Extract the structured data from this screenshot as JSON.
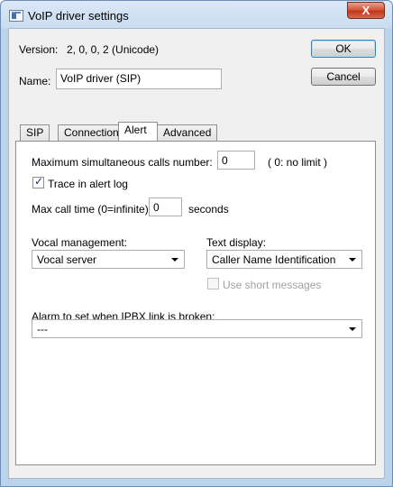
{
  "window": {
    "title": "VoIP driver settings",
    "close_glyph": "X"
  },
  "header": {
    "version_label": "Version:",
    "version_value": "2, 0, 0, 2 (Unicode)",
    "name_label": "Name:",
    "name_value": "VoIP driver (SIP)",
    "ok_label": "OK",
    "cancel_label": "Cancel"
  },
  "tabs": [
    {
      "label": "SIP"
    },
    {
      "label": "Connection"
    },
    {
      "label": "Alert"
    },
    {
      "label": "Advanced"
    }
  ],
  "alert": {
    "max_calls_label": "Maximum simultaneous calls number:",
    "max_calls_value": "0",
    "max_calls_hint": "( 0: no limit )",
    "trace_label": "Trace in alert log",
    "trace_checked": true,
    "max_time_label": "Max call time (0=infinite)",
    "max_time_value": "0",
    "max_time_unit": "seconds",
    "vocal_label": "Vocal management:",
    "vocal_value": "Vocal server",
    "text_display_label": "Text display:",
    "text_display_value": "Caller Name Identification",
    "short_messages_label": "Use short messages",
    "alarm_label": "Alarm to set when IPBX link is broken:",
    "alarm_value": "---"
  }
}
